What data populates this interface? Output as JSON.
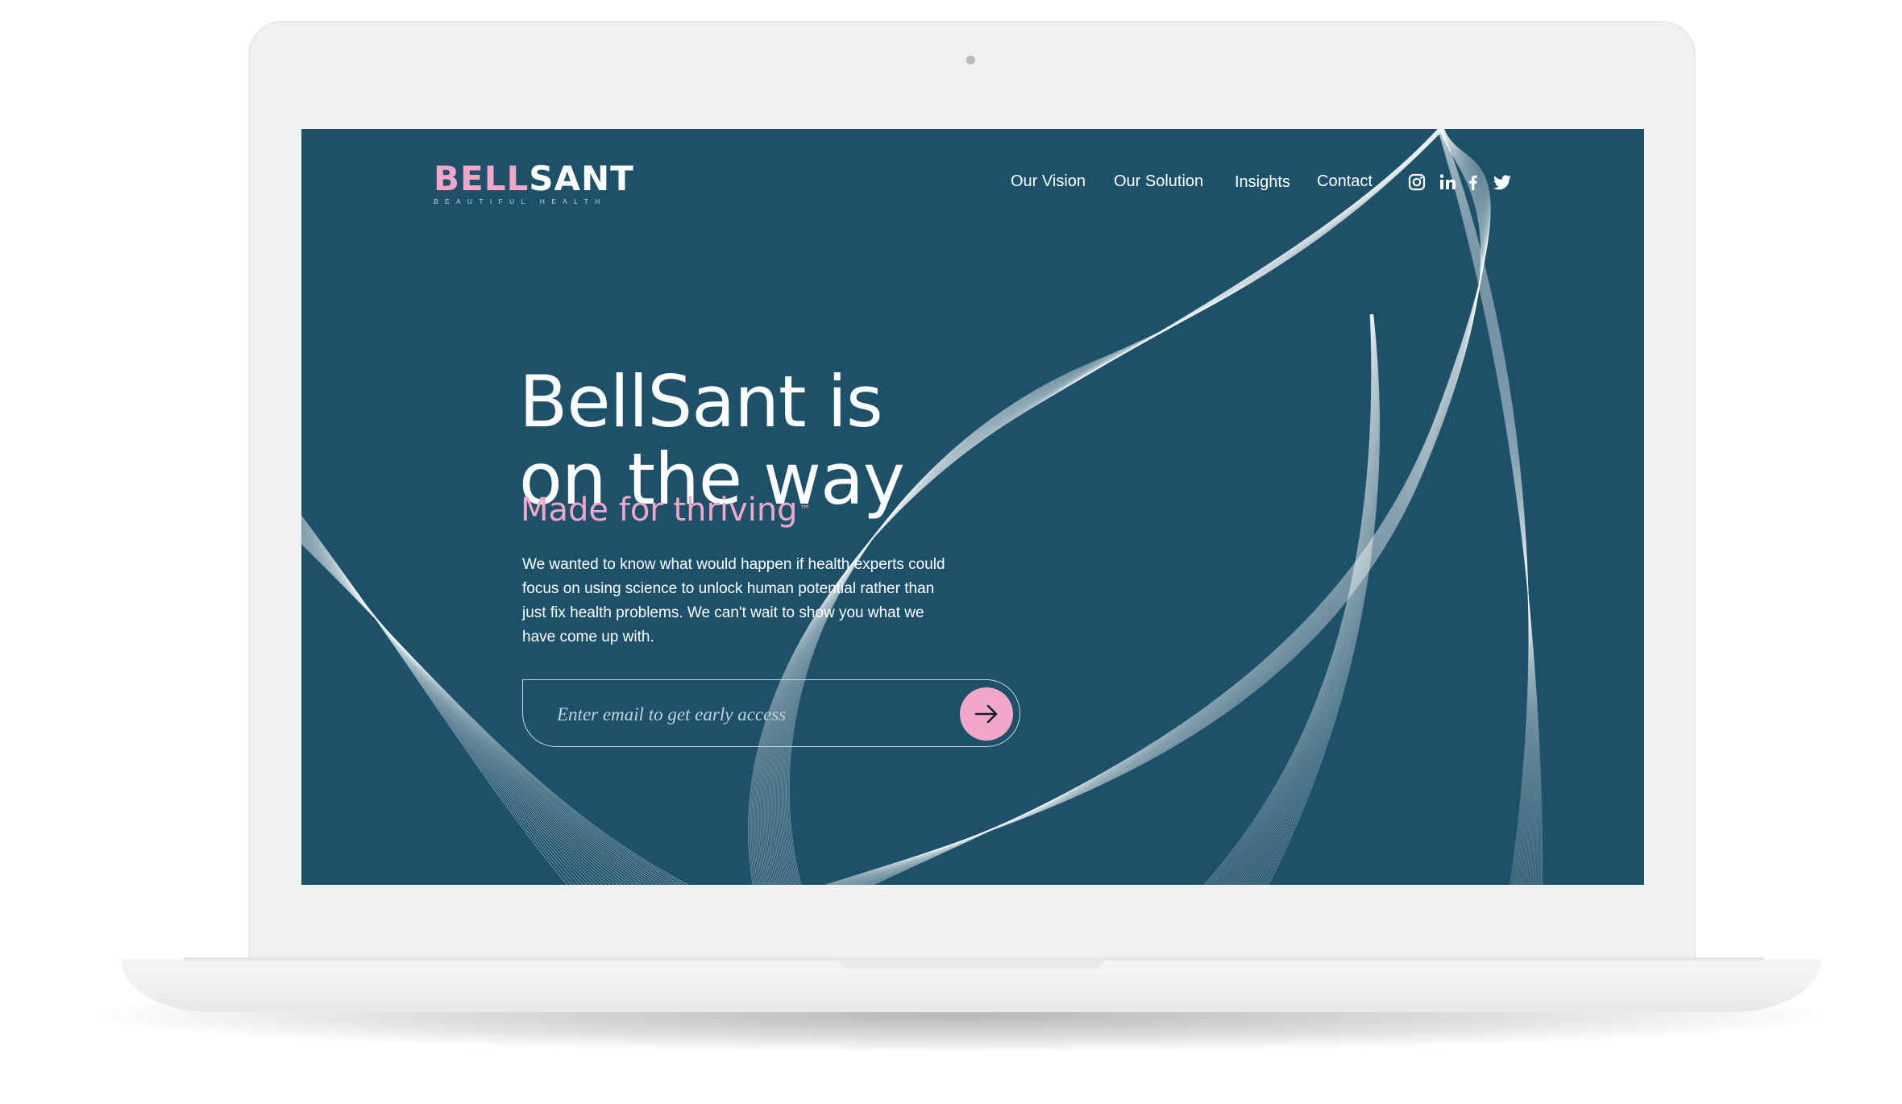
{
  "brand": {
    "logo_part1": "BELL",
    "logo_part2": "SANT",
    "tagline": "BEAUTIFUL HEALTH"
  },
  "nav": {
    "items": [
      {
        "label": "Our Vision"
      },
      {
        "label": "Our Solution"
      },
      {
        "label": "Insights"
      },
      {
        "label": "Contact"
      }
    ]
  },
  "social": [
    "instagram-icon",
    "linkedin-icon",
    "facebook-icon",
    "twitter-icon"
  ],
  "hero": {
    "headline_line1": "BellSant is",
    "headline_line2": "on the way",
    "subhead": "Made for thriving",
    "trademark": "™",
    "body": "We wanted to know what would happen if health experts could focus on using science to unlock human potential rather than just fix health problems. We can't wait to show you what we have come up with."
  },
  "signup": {
    "placeholder": "Enter email to get early access",
    "submit_icon": "arrow-right-icon"
  },
  "colors": {
    "background": "#1d5069",
    "accent_pink": "#f4a6c8",
    "text": "#ffffff",
    "laptop_body": "#f1f1f1"
  }
}
